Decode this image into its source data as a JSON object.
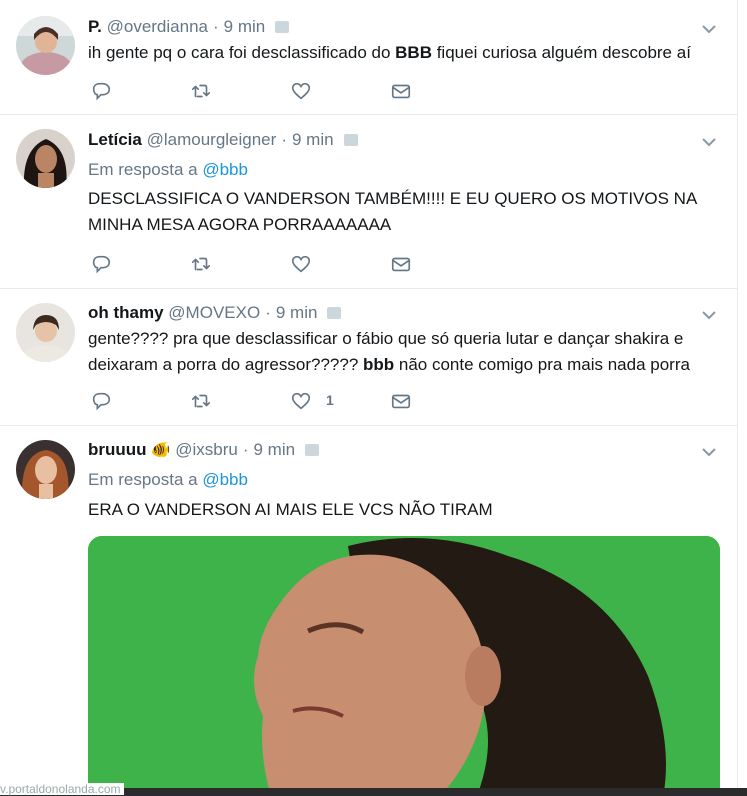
{
  "tweets": [
    {
      "name": "P.",
      "handle": "@overdianna",
      "time": "9 min",
      "text_parts": [
        "ih gente pq o cara foi desclassificado do ",
        "BBB",
        " fiquei curiosa alguém descobre aí"
      ],
      "avatar": "avatar-photo-girl-pink"
    },
    {
      "name": "Letícia",
      "handle": "@lamourgleigner",
      "time": "9 min",
      "reply_prefix": "Em resposta a",
      "reply_to": "@bbb",
      "text": "DESCLASSIFICA O VANDERSON TAMBÉM!!!! E EU QUERO OS MOTIVOS NA MINHA MESA AGORA PORRAAAAAAA",
      "avatar": "avatar-photo-dark-hair"
    },
    {
      "name": "oh thamy",
      "handle": "@MOVEXO",
      "time": "9 min",
      "text_parts": [
        "gente???? pra que desclassificar o fábio que só queria lutar e dançar shakira e deixaram a porra do agressor????? ",
        "bbb",
        " não conte comigo pra mais nada porra"
      ],
      "like_count": "1",
      "avatar": "avatar-photo-boy"
    },
    {
      "name": "bruuuu",
      "emoji": "🐠",
      "handle": "@ixsbru",
      "time": "9 min",
      "reply_prefix": "Em resposta a",
      "reply_to": "@bbb",
      "text": "ERA O VANDERSON AI MAIS ELE VCS NÃO TIRAM",
      "media": "gif-woman-green-screen",
      "avatar": "avatar-photo-red-hair"
    }
  ],
  "footer": {
    "url": "v.portaldonolanda.com"
  },
  "colors": {
    "link": "#1b95e0",
    "muted": "#657786",
    "border": "#e6ecf0",
    "green": "#3fb24a"
  },
  "icons": [
    "reply-icon",
    "retweet-icon",
    "like-icon",
    "dm-icon",
    "chevron-down-icon"
  ]
}
